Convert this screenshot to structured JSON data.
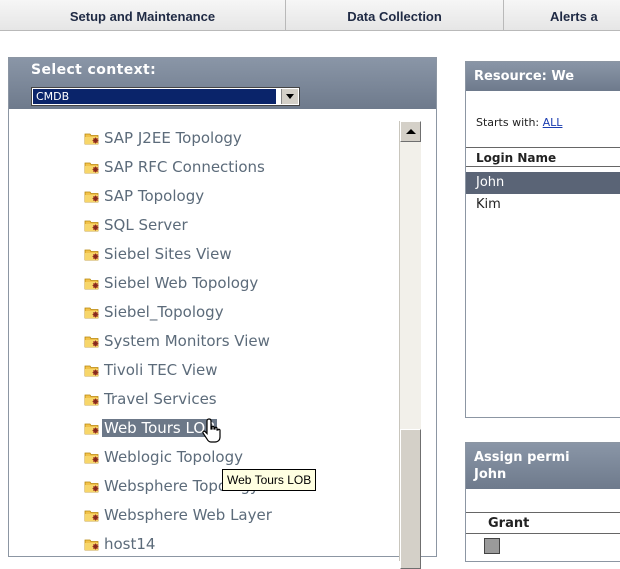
{
  "tabs": [
    {
      "label": "Setup and Maintenance"
    },
    {
      "label": "Data Collection"
    },
    {
      "label": "Alerts a"
    }
  ],
  "context": {
    "label": "Select context:",
    "selected": "CMDB"
  },
  "tree": {
    "items": [
      {
        "label": "SAP J2EE Topology"
      },
      {
        "label": "SAP RFC Connections"
      },
      {
        "label": "SAP Topology"
      },
      {
        "label": "SQL Server"
      },
      {
        "label": "Siebel Sites View"
      },
      {
        "label": "Siebel Web Topology"
      },
      {
        "label": "Siebel_Topology"
      },
      {
        "label": "System Monitors View"
      },
      {
        "label": "Tivoli TEC View"
      },
      {
        "label": "Travel Services"
      },
      {
        "label": "Web Tours LOB"
      },
      {
        "label": "Weblogic Topology"
      },
      {
        "label": "Websphere Topology"
      },
      {
        "label": "Websphere Web Layer"
      },
      {
        "label": "host14"
      }
    ],
    "selected_index": 10,
    "tooltip": "Web Tours LOB"
  },
  "resource": {
    "title": "Resource: We",
    "starts_with_label": "Starts with:",
    "starts_with_link": "ALL",
    "column_header": "Login Name",
    "rows": [
      "John",
      "Kim"
    ],
    "selected_row": "John"
  },
  "assign": {
    "title_line1": "Assign permi",
    "title_line2": "John",
    "grant_header": "Grant"
  },
  "colors": {
    "header_gradient_top": "#8a96a7",
    "selection": "#6c7888",
    "tree_text": "#5c6b7a",
    "select_highlight": "#0a246a"
  }
}
